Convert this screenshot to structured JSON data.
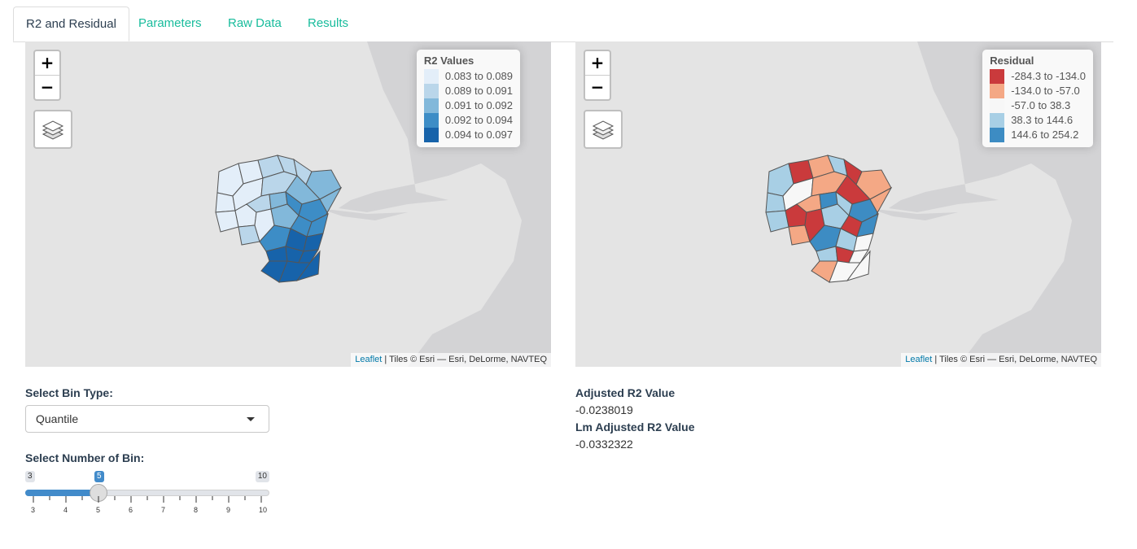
{
  "tabs": [
    "R2 and Residual",
    "Parameters",
    "Raw Data",
    "Results"
  ],
  "map_left": {
    "legend_title": "R2 Values",
    "legend": [
      {
        "label": "0.083 to 0.089",
        "color": "#e3eef9"
      },
      {
        "label": "0.089 to 0.091",
        "color": "#bad6ea"
      },
      {
        "label": "0.091 to 0.092",
        "color": "#82b8da"
      },
      {
        "label": "0.092 to 0.094",
        "color": "#3d8dc6"
      },
      {
        "label": "0.094 to 0.097",
        "color": "#1763aa"
      }
    ]
  },
  "map_right": {
    "legend_title": "Residual",
    "legend": [
      {
        "label": "-284.3 to -134.0",
        "color": "#ca3a3c"
      },
      {
        "label": "-134.0 to -57.0",
        "color": "#f4a885"
      },
      {
        "label": "-57.0 to 38.3",
        "color": "#f7f7f7"
      },
      {
        "label": "38.3 to 144.6",
        "color": "#a8cfe5"
      },
      {
        "label": "144.6 to 254.2",
        "color": "#3d8cc3"
      }
    ]
  },
  "zoom": {
    "in": "+",
    "out": "−"
  },
  "attribution": {
    "leaflet": "Leaflet",
    "rest": " | Tiles © Esri — Esri, DeLorme, NAVTEQ"
  },
  "bin_type": {
    "label": "Select Bin Type:",
    "value": "Quantile"
  },
  "bin_number": {
    "label": "Select Number of Bin:",
    "min": 3,
    "max": 10,
    "value": 5,
    "min_text": "3",
    "max_text": "10",
    "value_text": "5",
    "tick_labels": [
      "3",
      "4",
      "5",
      "6",
      "7",
      "8",
      "9",
      "10"
    ]
  },
  "stats": {
    "adj_label": "Adjusted R2 Value",
    "adj_value": "-0.0238019",
    "lm_label": "Lm Adjusted R2 Value",
    "lm_value": "-0.0332322"
  }
}
